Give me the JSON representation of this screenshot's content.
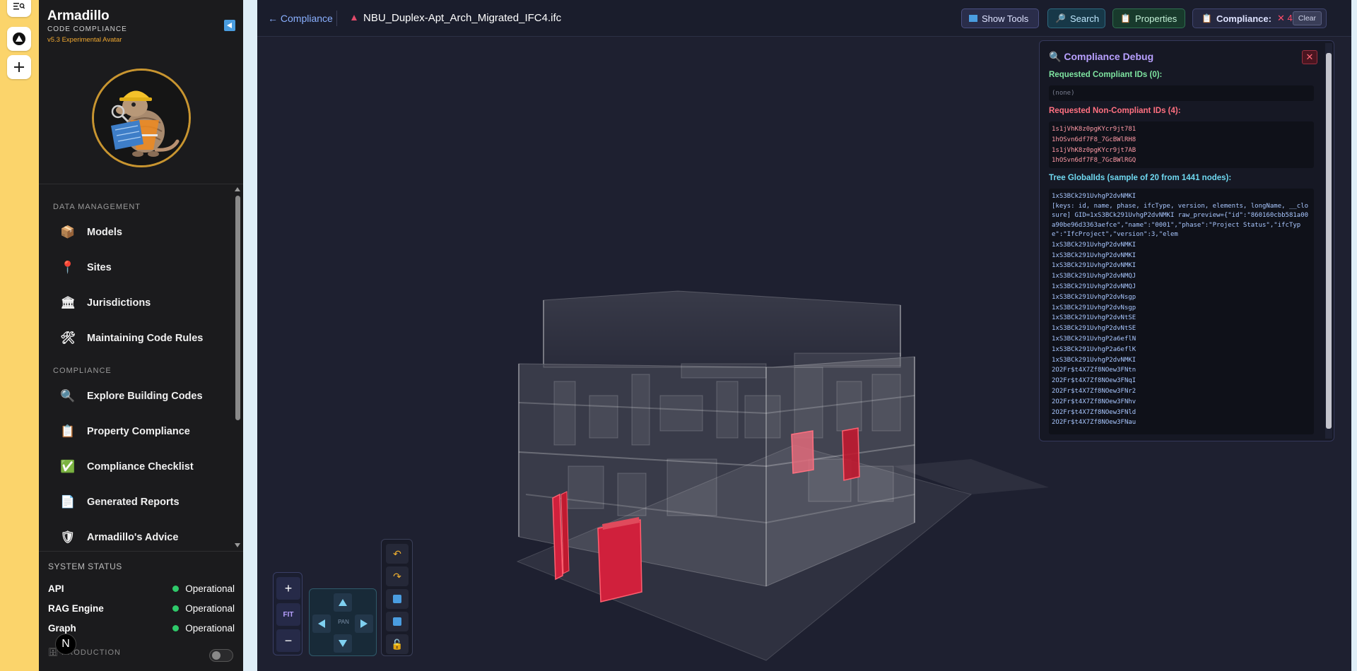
{
  "rail": {
    "icons": [
      "search-list-icon",
      "vercel-icon",
      "plus-icon"
    ]
  },
  "brand": {
    "title": "Armadillo",
    "subtitle": "CODE COMPLIANCE",
    "version": "v5.3 Experimental Avatar"
  },
  "nav": {
    "sections": [
      {
        "label": "DATA MANAGEMENT",
        "items": [
          {
            "label": "Models",
            "icon": "box-icon"
          },
          {
            "label": "Sites",
            "icon": "pin-icon"
          },
          {
            "label": "Jurisdictions",
            "icon": "bank-icon"
          },
          {
            "label": "Maintaining Code Rules",
            "icon": "tools-icon"
          }
        ]
      },
      {
        "label": "COMPLIANCE",
        "items": [
          {
            "label": "Explore Building Codes",
            "icon": "magnifier-icon"
          },
          {
            "label": "Property Compliance",
            "icon": "clipboard-icon"
          },
          {
            "label": "Compliance Checklist",
            "icon": "check-icon"
          },
          {
            "label": "Generated Reports",
            "icon": "document-icon"
          },
          {
            "label": "Armadillo's Advice",
            "icon": "shield-icon"
          }
        ]
      }
    ]
  },
  "system_status": {
    "title": "SYSTEM STATUS",
    "rows": [
      {
        "name": "API",
        "state": "Operational"
      },
      {
        "name": "RAG Engine",
        "state": "Operational"
      },
      {
        "name": "Graph",
        "state": "Operational"
      }
    ],
    "mode": "PRODUCTION",
    "mode_on": false
  },
  "toolbar": {
    "back_label": "← Compliance",
    "file_name": "NBU_Duplex-Apt_Arch_Migrated_IFC4.ifc",
    "show_tools": "Show Tools",
    "search": "Search",
    "properties": "Properties",
    "compliance_label": "Compliance:",
    "compliance_fail": "✕ 4",
    "clear": "Clear"
  },
  "debug": {
    "title": "Compliance Debug",
    "close": "✕",
    "compliant_heading": "Requested Compliant IDs (0):",
    "compliant_empty": "(none)",
    "noncompliant_heading": "Requested Non-Compliant IDs (4):",
    "noncompliant_ids": [
      "1s1jVhK8z0pgKYcr9jt781",
      "1hOSvn6df7F8_7GcBWlRH8",
      "1s1jVhK8z0pgKYcr9jt7AB",
      "1hOSvn6df7F8_7GcBWlRGQ"
    ],
    "tree_heading": "Tree GlobalIds (sample of 20 from 1441 nodes):",
    "tree_first": "1xS3BCk291UvhgP2dvNMKI",
    "tree_keys": "[keys: id, name, phase, ifcType, version, elements, longName, __closure] GID=1xS3BCk291UvhgP2dvNMKI raw_preview={\"id\":\"860160cbb581a00a90be96d3363aefce\",\"name\":\"0001\",\"phase\":\"Project Status\",\"ifcType\":\"IfcProject\",\"version\":3,\"elem",
    "tree_ids": [
      "1xS3BCk291UvhgP2dvNMKI",
      "1xS3BCk291UvhgP2dvNMKI",
      "1xS3BCk291UvhgP2dvNMKI",
      "1xS3BCk291UvhgP2dvNMQJ",
      "1xS3BCk291UvhgP2dvNMQJ",
      "1xS3BCk291UvhgP2dvNsgp",
      "1xS3BCk291UvhgP2dvNsgp",
      "1xS3BCk291UvhgP2dvNtSE",
      "1xS3BCk291UvhgP2dvNtSE",
      "1xS3BCk291UvhgP2a6eflN",
      "1xS3BCk291UvhgP2a6eflK",
      "1xS3BCk291UvhgP2dvNMKI",
      "2O2Fr$t4X7Zf8NOew3FNtn",
      "2O2Fr$t4X7Zf8NOew3FNqI",
      "2O2Fr$t4X7Zf8NOew3FNr2",
      "2O2Fr$t4X7Zf8NOew3FNhv",
      "2O2Fr$t4X7Zf8NOew3FNld",
      "2O2Fr$t4X7Zf8NOew3FNau"
    ]
  },
  "controls": {
    "zoom_in": "+",
    "fit": "FIT",
    "zoom_out": "−",
    "pan_label": "PAN"
  },
  "next_badge": "N",
  "colors": {
    "accent_purple": "#b8a0ff",
    "noncompliant_red": "#d0203c",
    "operational_green": "#2fc96a",
    "brand_orange": "#f0a830"
  }
}
